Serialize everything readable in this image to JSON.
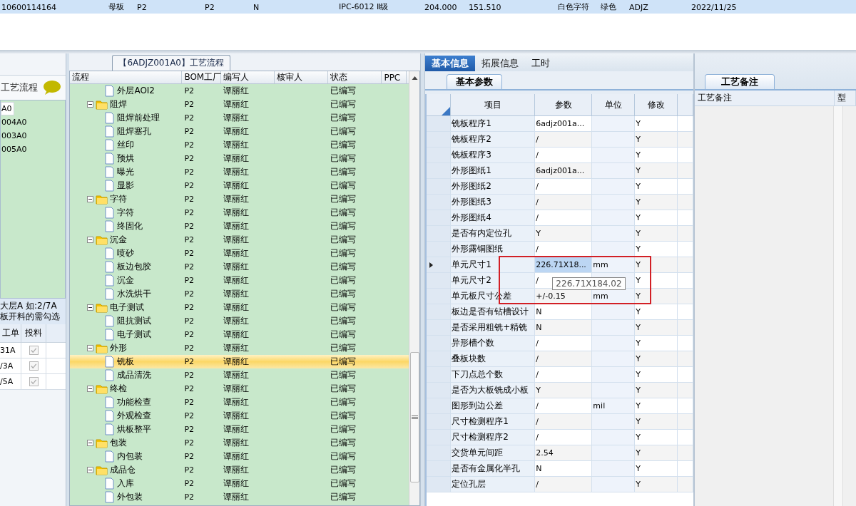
{
  "top_row": {
    "selected": true,
    "cells": [
      "10600114164",
      "母板",
      "P2",
      "P2",
      "N",
      "IPC-6012 Ⅱ级",
      "204.000",
      "151.510",
      "白色字符",
      "绿色",
      "ADJZ",
      "2022/11/25"
    ]
  },
  "left_panel": {
    "title": "工艺流程",
    "items": [
      {
        "label": "A0",
        "selected": true
      },
      {
        "label": "004A0",
        "selected": false
      },
      {
        "label": "003A0",
        "selected": false
      },
      {
        "label": "005A0",
        "selected": false
      }
    ],
    "note": [
      "大层A 如:2/7A",
      "板开料的需勾选"
    ],
    "table": {
      "columns": [
        "工单",
        "投料"
      ],
      "rows": [
        {
          "order": "31A",
          "checked": true,
          "disabled": true
        },
        {
          "order": "/3A",
          "checked": true,
          "disabled": true
        },
        {
          "order": "/5A",
          "checked": true,
          "disabled": true
        }
      ]
    }
  },
  "flow_panel": {
    "title": "【6ADJZ001A0】工艺流程",
    "columns": [
      "流程",
      "BOM工厂",
      "编写人",
      "核审人",
      "状态",
      "PPC"
    ],
    "nodes": [
      {
        "children": [
          {
            "name": "外层AOI2",
            "factory": "P2",
            "author": "谭丽红",
            "status": "已编写",
            "selected": false
          }
        ]
      },
      {
        "name": "阻焊",
        "factory": "P2",
        "author": "谭丽红",
        "status": "已编写",
        "selected": false,
        "expanded": true,
        "children": [
          {
            "name": "阻焊前处理",
            "factory": "P2",
            "author": "谭丽红",
            "status": "已编写",
            "selected": false
          },
          {
            "name": "阻焊塞孔",
            "factory": "P2",
            "author": "谭丽红",
            "status": "已编写",
            "selected": false
          },
          {
            "name": "丝印",
            "factory": "P2",
            "author": "谭丽红",
            "status": "已编写",
            "selected": false
          },
          {
            "name": "预烘",
            "factory": "P2",
            "author": "谭丽红",
            "status": "已编写",
            "selected": false
          },
          {
            "name": "曝光",
            "factory": "P2",
            "author": "谭丽红",
            "status": "已编写",
            "selected": false
          },
          {
            "name": "显影",
            "factory": "P2",
            "author": "谭丽红",
            "status": "已编写",
            "selected": false
          }
        ]
      },
      {
        "name": "字符",
        "factory": "P2",
        "author": "谭丽红",
        "status": "已编写",
        "selected": false,
        "expanded": true,
        "children": [
          {
            "name": "字符",
            "factory": "P2",
            "author": "谭丽红",
            "status": "已编写",
            "selected": false
          },
          {
            "name": "终固化",
            "factory": "P2",
            "author": "谭丽红",
            "status": "已编写",
            "selected": false
          }
        ]
      },
      {
        "name": "沉金",
        "factory": "P2",
        "author": "谭丽红",
        "status": "已编写",
        "selected": false,
        "expanded": true,
        "children": [
          {
            "name": "喷砂",
            "factory": "P2",
            "author": "谭丽红",
            "status": "已编写",
            "selected": false
          },
          {
            "name": "板边包胶",
            "factory": "P2",
            "author": "谭丽红",
            "status": "已编写",
            "selected": false
          },
          {
            "name": "沉金",
            "factory": "P2",
            "author": "谭丽红",
            "status": "已编写",
            "selected": false
          },
          {
            "name": "水洗烘干",
            "factory": "P2",
            "author": "谭丽红",
            "status": "已编写",
            "selected": false
          }
        ]
      },
      {
        "name": "电子测试",
        "factory": "P2",
        "author": "谭丽红",
        "status": "已编写",
        "selected": false,
        "expanded": true,
        "children": [
          {
            "name": "阻抗测试",
            "factory": "P2",
            "author": "谭丽红",
            "status": "已编写",
            "selected": false
          },
          {
            "name": "电子测试",
            "factory": "P2",
            "author": "谭丽红",
            "status": "已编写",
            "selected": false
          }
        ]
      },
      {
        "name": "外形",
        "factory": "P2",
        "author": "谭丽红",
        "status": "已编写",
        "selected": false,
        "expanded": true,
        "children": [
          {
            "name": "铣板",
            "factory": "P2",
            "author": "谭丽红",
            "status": "已编写",
            "selected": true
          },
          {
            "name": "成品清洗",
            "factory": "P2",
            "author": "谭丽红",
            "status": "已编写",
            "selected": false
          }
        ]
      },
      {
        "name": "终检",
        "factory": "P2",
        "author": "谭丽红",
        "status": "已编写",
        "selected": false,
        "expanded": true,
        "children": [
          {
            "name": "功能检查",
            "factory": "P2",
            "author": "谭丽红",
            "status": "已编写",
            "selected": false
          },
          {
            "name": "外观检查",
            "factory": "P2",
            "author": "谭丽红",
            "status": "已编写",
            "selected": false
          },
          {
            "name": "烘板整平",
            "factory": "P2",
            "author": "谭丽红",
            "status": "已编写",
            "selected": false
          }
        ]
      },
      {
        "name": "包装",
        "factory": "P2",
        "author": "谭丽红",
        "status": "已编写",
        "selected": false,
        "expanded": true,
        "children": [
          {
            "name": "内包装",
            "factory": "P2",
            "author": "谭丽红",
            "status": "已编写",
            "selected": false
          }
        ]
      },
      {
        "name": "成品仓",
        "factory": "P2",
        "author": "谭丽红",
        "status": "已编写",
        "selected": false,
        "expanded": true,
        "children": [
          {
            "name": "入库",
            "factory": "P2",
            "author": "谭丽红",
            "status": "已编写",
            "selected": false
          },
          {
            "name": "外包装",
            "factory": "P2",
            "author": "谭丽红",
            "status": "已编写",
            "selected": false
          }
        ]
      }
    ]
  },
  "info_panel": {
    "tabs": [
      {
        "label": "基本信息",
        "selected": true
      },
      {
        "label": "拓展信息",
        "selected": false
      },
      {
        "label": "工时",
        "selected": false
      }
    ],
    "sub_tab": "基本参数",
    "columns": [
      "项目",
      "参数",
      "单位",
      "修改"
    ],
    "rows": [
      {
        "item": "铣板程序1",
        "value": "6adjz001a...",
        "modified": "Y",
        "selected": false
      },
      {
        "item": "铣板程序2",
        "value": "/",
        "modified": "Y",
        "selected": false
      },
      {
        "item": "铣板程序3",
        "value": "/",
        "modified": "Y",
        "selected": false
      },
      {
        "item": "外形图纸1",
        "value": "6adjz001a...",
        "modified": "Y",
        "selected": false
      },
      {
        "item": "外形图纸2",
        "value": "/",
        "modified": "Y",
        "selected": false
      },
      {
        "item": "外形图纸3",
        "value": "/",
        "modified": "Y",
        "selected": false
      },
      {
        "item": "外形图纸4",
        "value": "/",
        "modified": "Y",
        "selected": false
      },
      {
        "item": "是否有内定位孔",
        "value": "Y",
        "modified": "Y",
        "selected": false
      },
      {
        "item": "外形露铜图纸",
        "value": "/",
        "modified": "Y",
        "selected": false
      },
      {
        "item": "单元尺寸1",
        "value": "226.71X18...",
        "unit": "mm",
        "modified": "Y",
        "selected": true
      },
      {
        "item": "单元尺寸2",
        "value": "/",
        "modified": "Y",
        "selected": false
      },
      {
        "item": "单元板尺寸公差",
        "value": "+/-0.15",
        "unit": "mm",
        "modified": "Y",
        "selected": false
      },
      {
        "item": "板边是否有钻槽设计",
        "value": "N",
        "modified": "Y",
        "selected": false
      },
      {
        "item": "是否采用粗铣+精铣",
        "value": "N",
        "modified": "Y",
        "selected": false
      },
      {
        "item": "异形槽个数",
        "value": "/",
        "modified": "Y",
        "selected": false
      },
      {
        "item": "叠板块数",
        "value": "/",
        "modified": "Y",
        "selected": false
      },
      {
        "item": "下刀点总个数",
        "value": "/",
        "modified": "Y",
        "selected": false
      },
      {
        "item": "是否为大板铣成小板",
        "value": "Y",
        "modified": "Y",
        "selected": false
      },
      {
        "item": "图形到边公差",
        "value": "/",
        "unit": "mil",
        "modified": "Y",
        "selected": false
      },
      {
        "item": "尺寸检测程序1",
        "value": "/",
        "modified": "Y",
        "selected": false
      },
      {
        "item": "尺寸检测程序2",
        "value": "/",
        "modified": "Y",
        "selected": false
      },
      {
        "item": "交货单元间距",
        "value": "2.54",
        "modified": "Y",
        "selected": false
      },
      {
        "item": "是否有金属化半孔",
        "value": "N",
        "modified": "Y",
        "selected": false
      },
      {
        "item": "定位孔层",
        "value": "/",
        "modified": "Y",
        "selected": false
      }
    ],
    "tooltip": "226.71X184.02"
  },
  "remarks_panel": {
    "tab": "工艺备注",
    "columns": [
      "工艺备注",
      "型"
    ]
  }
}
